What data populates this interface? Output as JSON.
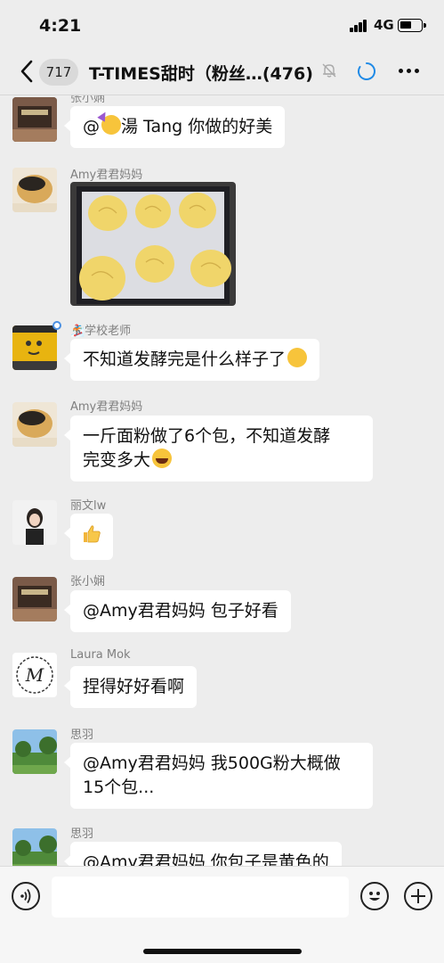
{
  "status_bar": {
    "time": "4:21",
    "network": "4G"
  },
  "nav": {
    "unread_count": "717",
    "title": "T-TIMES甜时（粉丝…(476)",
    "icons": [
      "back-icon",
      "mute-bell-icon",
      "loading-icon",
      "more-icon"
    ]
  },
  "messages": [
    {
      "sender": "张小娴",
      "text": "@🥳湯 Tang 你做的好美"
    },
    {
      "sender": "Amy君君妈妈",
      "type": "image",
      "image_desc": "buns-on-baking-tray"
    },
    {
      "sender": "🏂学校老师",
      "text": "不知道发酵完是什么样子了🤔"
    },
    {
      "sender": "Amy君君妈妈",
      "text_line1": "一斤面粉做了6个包，不知道发酵",
      "text_line2": "完变多大😂"
    },
    {
      "sender": "丽文lw",
      "text": "👍"
    },
    {
      "sender": "张小娴",
      "text": "@Amy君君妈妈 包子好看"
    },
    {
      "sender": "Laura Mok",
      "text": "捏得好好看啊"
    },
    {
      "sender": "思羽",
      "text_line1": "@Amy君君妈妈 我500G粉大概做",
      "text_line2": "15个包..."
    },
    {
      "sender": "思羽",
      "text": "@Amy君君妈妈 你包子是黄色的"
    }
  ],
  "colors": {
    "background": "#ededed",
    "bubble": "#ffffff",
    "input_bar": "#f6f6f6",
    "accent": "#1aad19"
  },
  "input_bar": {
    "icons": [
      "voice-icon",
      "emoji-icon",
      "plus-icon"
    ]
  }
}
